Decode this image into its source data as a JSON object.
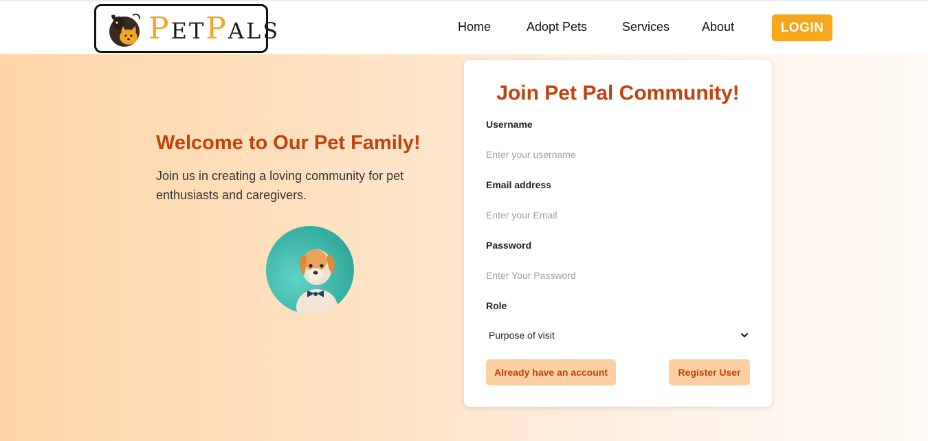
{
  "brand": {
    "name_first_letter": "P",
    "name_first_rest": "ET",
    "name_second_letter": "P",
    "name_second_rest": "ALS"
  },
  "nav": {
    "links": [
      "Home",
      "Adopt Pets",
      "Services",
      "About"
    ],
    "login_label": "LOGIN"
  },
  "hero": {
    "title": "Welcome to Our Pet Family!",
    "text": "Join us in creating a loving community for pet enthusiasts and caregivers."
  },
  "form": {
    "title": "Join Pet Pal Community!",
    "username_label": "Username",
    "username_placeholder": "Enter your username",
    "email_label": "Email address",
    "email_placeholder": "Enter your Email",
    "password_label": "Password",
    "password_placeholder": "Enter Your Password",
    "role_label": "Role",
    "role_selected": "Purpose of visit",
    "login_link_label": "Already have an account",
    "register_label": "Register User"
  },
  "colors": {
    "accent": "#c2410c",
    "login_button": "#f7a71b",
    "soft_button": "#fdd0a2",
    "logo_orange": "#f4a623"
  },
  "icons": {
    "logo": "dog-and-cat-logo-icon",
    "select_arrow": "chevron-down-icon"
  }
}
